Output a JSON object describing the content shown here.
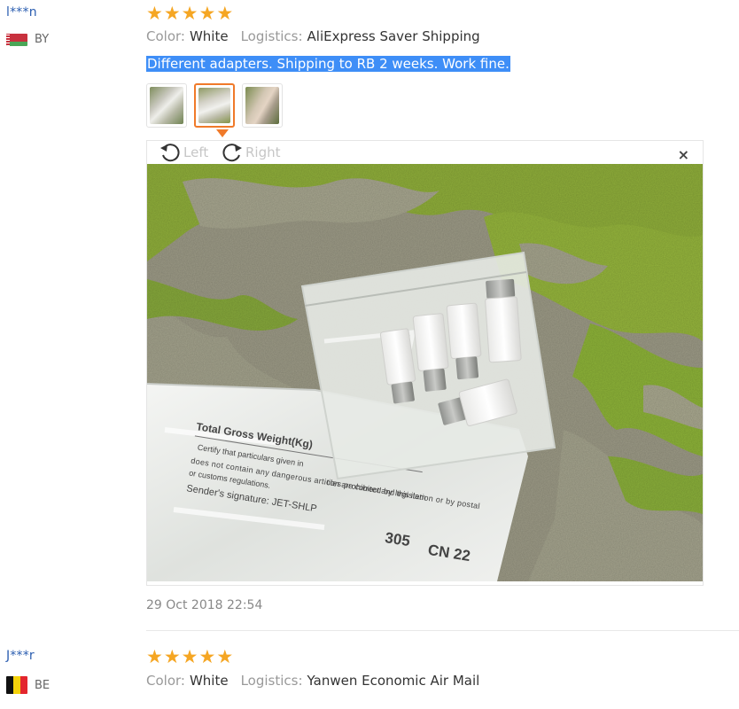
{
  "reviews": [
    {
      "user": "l***n",
      "country": "BY",
      "rating": 5,
      "color_label": "Color:",
      "color_value": "White",
      "logistics_label": "Logistics:",
      "logistics_value": "AliExpress Saver Shipping",
      "text": "Different adapters. Shipping to RB 2 weeks. Work fine.",
      "thumbnails": 3,
      "active_thumbnail": 2,
      "viewer": {
        "rotate_left": "Left",
        "rotate_right": "Right",
        "close": "×",
        "photo_label_title": "Total Gross Weight(Kg)",
        "photo_label_cert1": "Certify that particulars given in",
        "photo_label_cert2": "does not contain any dangerous articles prohibited by legislation or by postal",
        "photo_label_cert3": "or customs regulations.",
        "photo_label_sig": "Sender's signature: JET-SHLP",
        "photo_label_code": "305",
        "photo_label_cn": "CN 22",
        "photo_label_fragment": "tion are correct and this item"
      },
      "date": "29 Oct 2018 22:54"
    },
    {
      "user": "J***r",
      "country": "BE",
      "rating": 5,
      "color_label": "Color:",
      "color_value": "White",
      "logistics_label": "Logistics:",
      "logistics_value": "Yanwen Economic Air Mail"
    }
  ],
  "colors": {
    "star": "#f5a623",
    "username": "#2a5db0",
    "highlight": "#3e8ef7",
    "active_thumb_border": "#f07a2a"
  },
  "icons": [
    "star-icon",
    "rotate-left-icon",
    "rotate-right-icon",
    "close-icon",
    "flag-icon"
  ]
}
